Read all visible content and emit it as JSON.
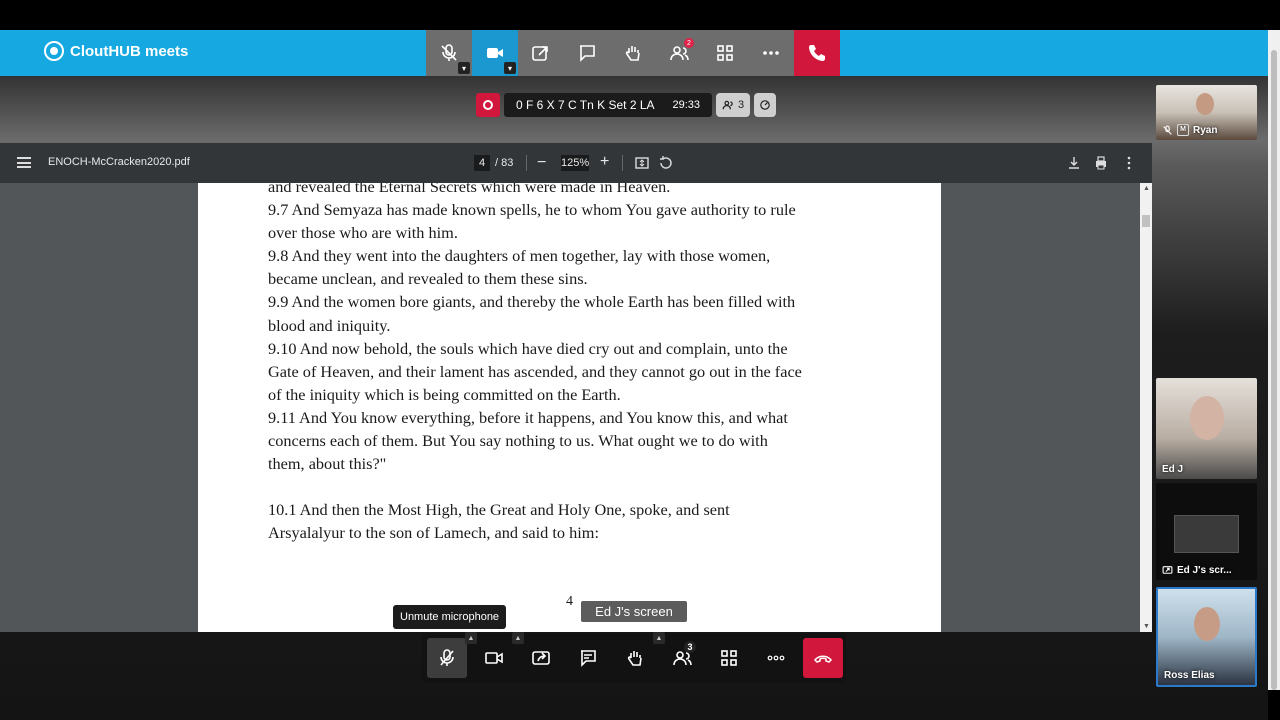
{
  "app": {
    "brand": "ClоutHUB meets"
  },
  "meeting": {
    "title": "0 F 6 X 7 C Tn K Set 2 LA",
    "timer": "29:33",
    "participants_count": "3",
    "notification_badge": "2"
  },
  "pdf": {
    "filename": "ENOCH-McCracken2020.pdf",
    "page_current": "4",
    "page_total": "/ 83",
    "zoom": "125%",
    "page_number": "4",
    "lines": [
      "and revealed the Eternal Secrets which were made in Heaven.",
      "9.7 And Semyaza has made known spells, he to whom You gave authority to rule",
      "over those who are with him.",
      "9.8 And they went into the daughters of men together, lay with those women,",
      "became unclean, and revealed to them these sins.",
      "9.9 And the women bore giants, and thereby the whole Earth has been filled with",
      "blood and iniquity.",
      "9.10 And now behold, the souls which have died cry out and complain, unto the",
      "Gate of Heaven, and their lament has ascended, and they cannot go out in the face",
      "of the iniquity which is being committed on the Earth.",
      "9.11 And You know everything, before it happens, and You know this, and what",
      "concerns each of them.  But You say nothing to us.  What ought we to do with",
      "them, about this?\"",
      "",
      "10.1 And then the Most High, the Great and Holy One, spoke, and sent",
      "Arsyalalyur to the son of Lamech, and said to him:"
    ]
  },
  "tooltip": "Unmute microphone",
  "screen_label": "Ed J's screen",
  "bottom_participants_count": "3",
  "tiles": [
    {
      "name": "Ryan",
      "mini": "M"
    },
    {
      "name": "Ed J"
    },
    {
      "name": "Ed J's scr..."
    },
    {
      "name": "Ross Elias"
    }
  ],
  "colors": {
    "brand": "#16a9e1",
    "end_call": "#d1173b",
    "active_video": "#1a98cf"
  }
}
